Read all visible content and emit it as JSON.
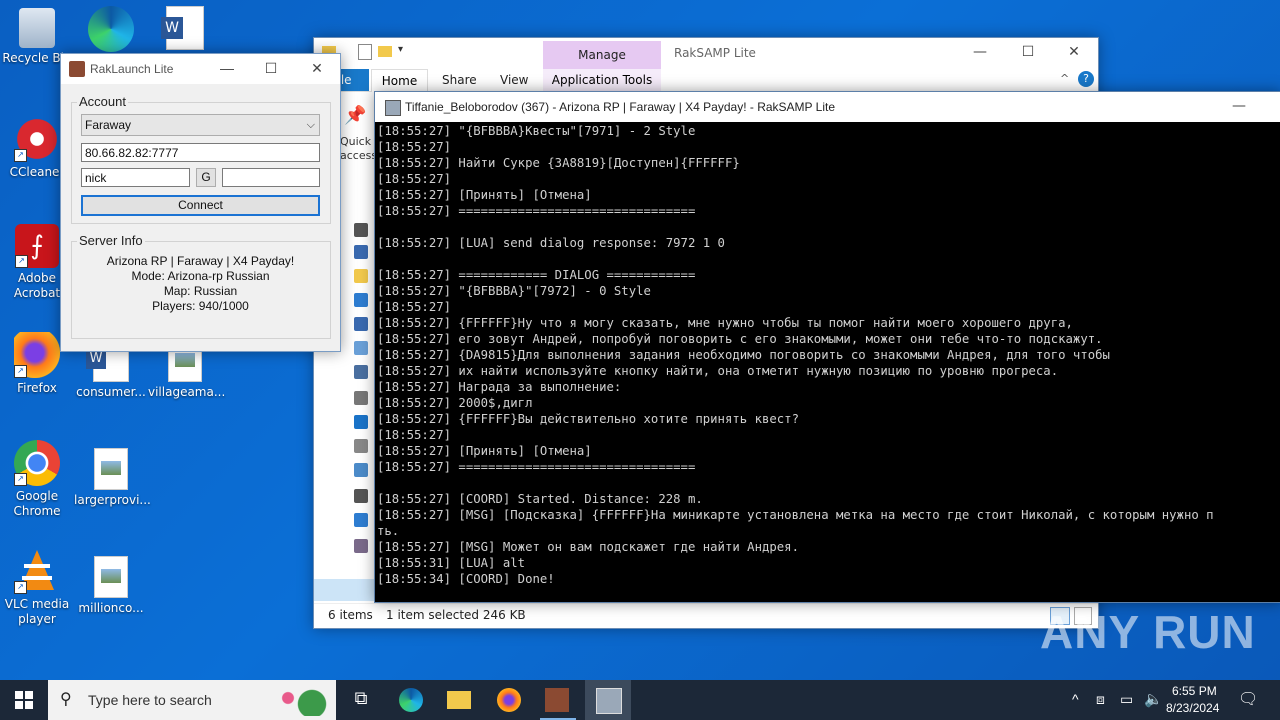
{
  "desktop": {
    "icons": [
      {
        "label": "Recycle Bin",
        "icon": "recycle-bin-icon"
      },
      {
        "label": "CCleaner",
        "icon": "ccleaner-icon"
      },
      {
        "label": "Adobe Acrobat",
        "icon": "acrobat-icon"
      },
      {
        "label": "Firefox",
        "icon": "firefox-icon"
      },
      {
        "label": "Google Chrome",
        "icon": "chrome-icon"
      },
      {
        "label": "VLC media player",
        "icon": "vlc-icon"
      },
      {
        "label": "consumer...",
        "icon": "word-doc-icon"
      },
      {
        "label": "villageama...",
        "icon": "image-file-icon"
      },
      {
        "label": "largerprovi...",
        "icon": "image-file-icon"
      },
      {
        "label": "millionco...",
        "icon": "image-file-icon"
      }
    ]
  },
  "explorer": {
    "manage_label": "Manage",
    "title": "RakSAMP Lite",
    "tabs": {
      "file": "File",
      "home": "Home",
      "share": "Share",
      "view": "View",
      "app_tools": "Application Tools"
    },
    "sidebar_partial": [
      "Quick",
      "access"
    ],
    "status": {
      "items": "6 items",
      "selected": "1 item selected  246 KB"
    }
  },
  "launcher": {
    "title": "RakLaunch Lite",
    "account_label": "Account",
    "server_select": "Faraway",
    "address": "80.66.82.82:7777",
    "nick": "nick",
    "g_button": "G",
    "password": "",
    "connect_button": "Connect",
    "server_info_label": "Server Info",
    "server_info": {
      "name": "Arizona RP | Faraway | X4 Payday!",
      "mode": "Mode: Arizona-rp Russian",
      "map": "Map: Russian",
      "players": "Players: 940/1000"
    }
  },
  "console": {
    "title": "Tiffanie_Beloborodov (367) - Arizona RP | Faraway | X4 Payday! - RakSAMP Lite",
    "lines": [
      "[18:55:27] \"{BFBBBA}Квесты\"[7971] - 2 Style",
      "[18:55:27]",
      "[18:55:27] Найти Сукре {3A8819}[Доступен]{FFFFFF}",
      "[18:55:27]",
      "[18:55:27] [Принять] [Отмена]",
      "[18:55:27] ================================",
      "",
      "[18:55:27] [LUA] send dialog response: 7972 1 0",
      "",
      "[18:55:27] ============ DIALOG ============",
      "[18:55:27] \"{BFBBBA}\"[7972] - 0 Style",
      "[18:55:27]",
      "[18:55:27] {FFFFFF}Ну что я могу сказать, мне нужно чтобы ты помог найти моего хорошего друга,",
      "[18:55:27] его зовут Андрей, попробуй поговорить с его знакомыми, может они тебе что-то подскажут.",
      "[18:55:27] {DA9815}Для выполнения задания необходимо поговорить со знакомыми Андрея, для того чтобы",
      "[18:55:27] их найти используйте кнопку найти, она отметит нужную позицию по уровню прогреса.",
      "[18:55:27] Награда за выполнение:",
      "[18:55:27] 2000$,дигл",
      "[18:55:27] {FFFFFF}Вы действительно хотите принять квест?",
      "[18:55:27]",
      "[18:55:27] [Принять] [Отмена]",
      "[18:55:27] ================================",
      "",
      "[18:55:27] [COORD] Started. Distance: 228 m.",
      "[18:55:27] [MSG] [Подсказка] {FFFFFF}На миникарте установлена метка на место где стоит Николай, с которым нужно п",
      "ть.",
      "[18:55:27] [MSG] Может он вам подскажет где найти Андрея.",
      "[18:55:31] [LUA] alt",
      "[18:55:34] [COORD] Done!"
    ]
  },
  "taskbar": {
    "search_placeholder": "Type here to search",
    "time": "6:55 PM",
    "date": "8/23/2024"
  },
  "watermark": "ANY RUN"
}
